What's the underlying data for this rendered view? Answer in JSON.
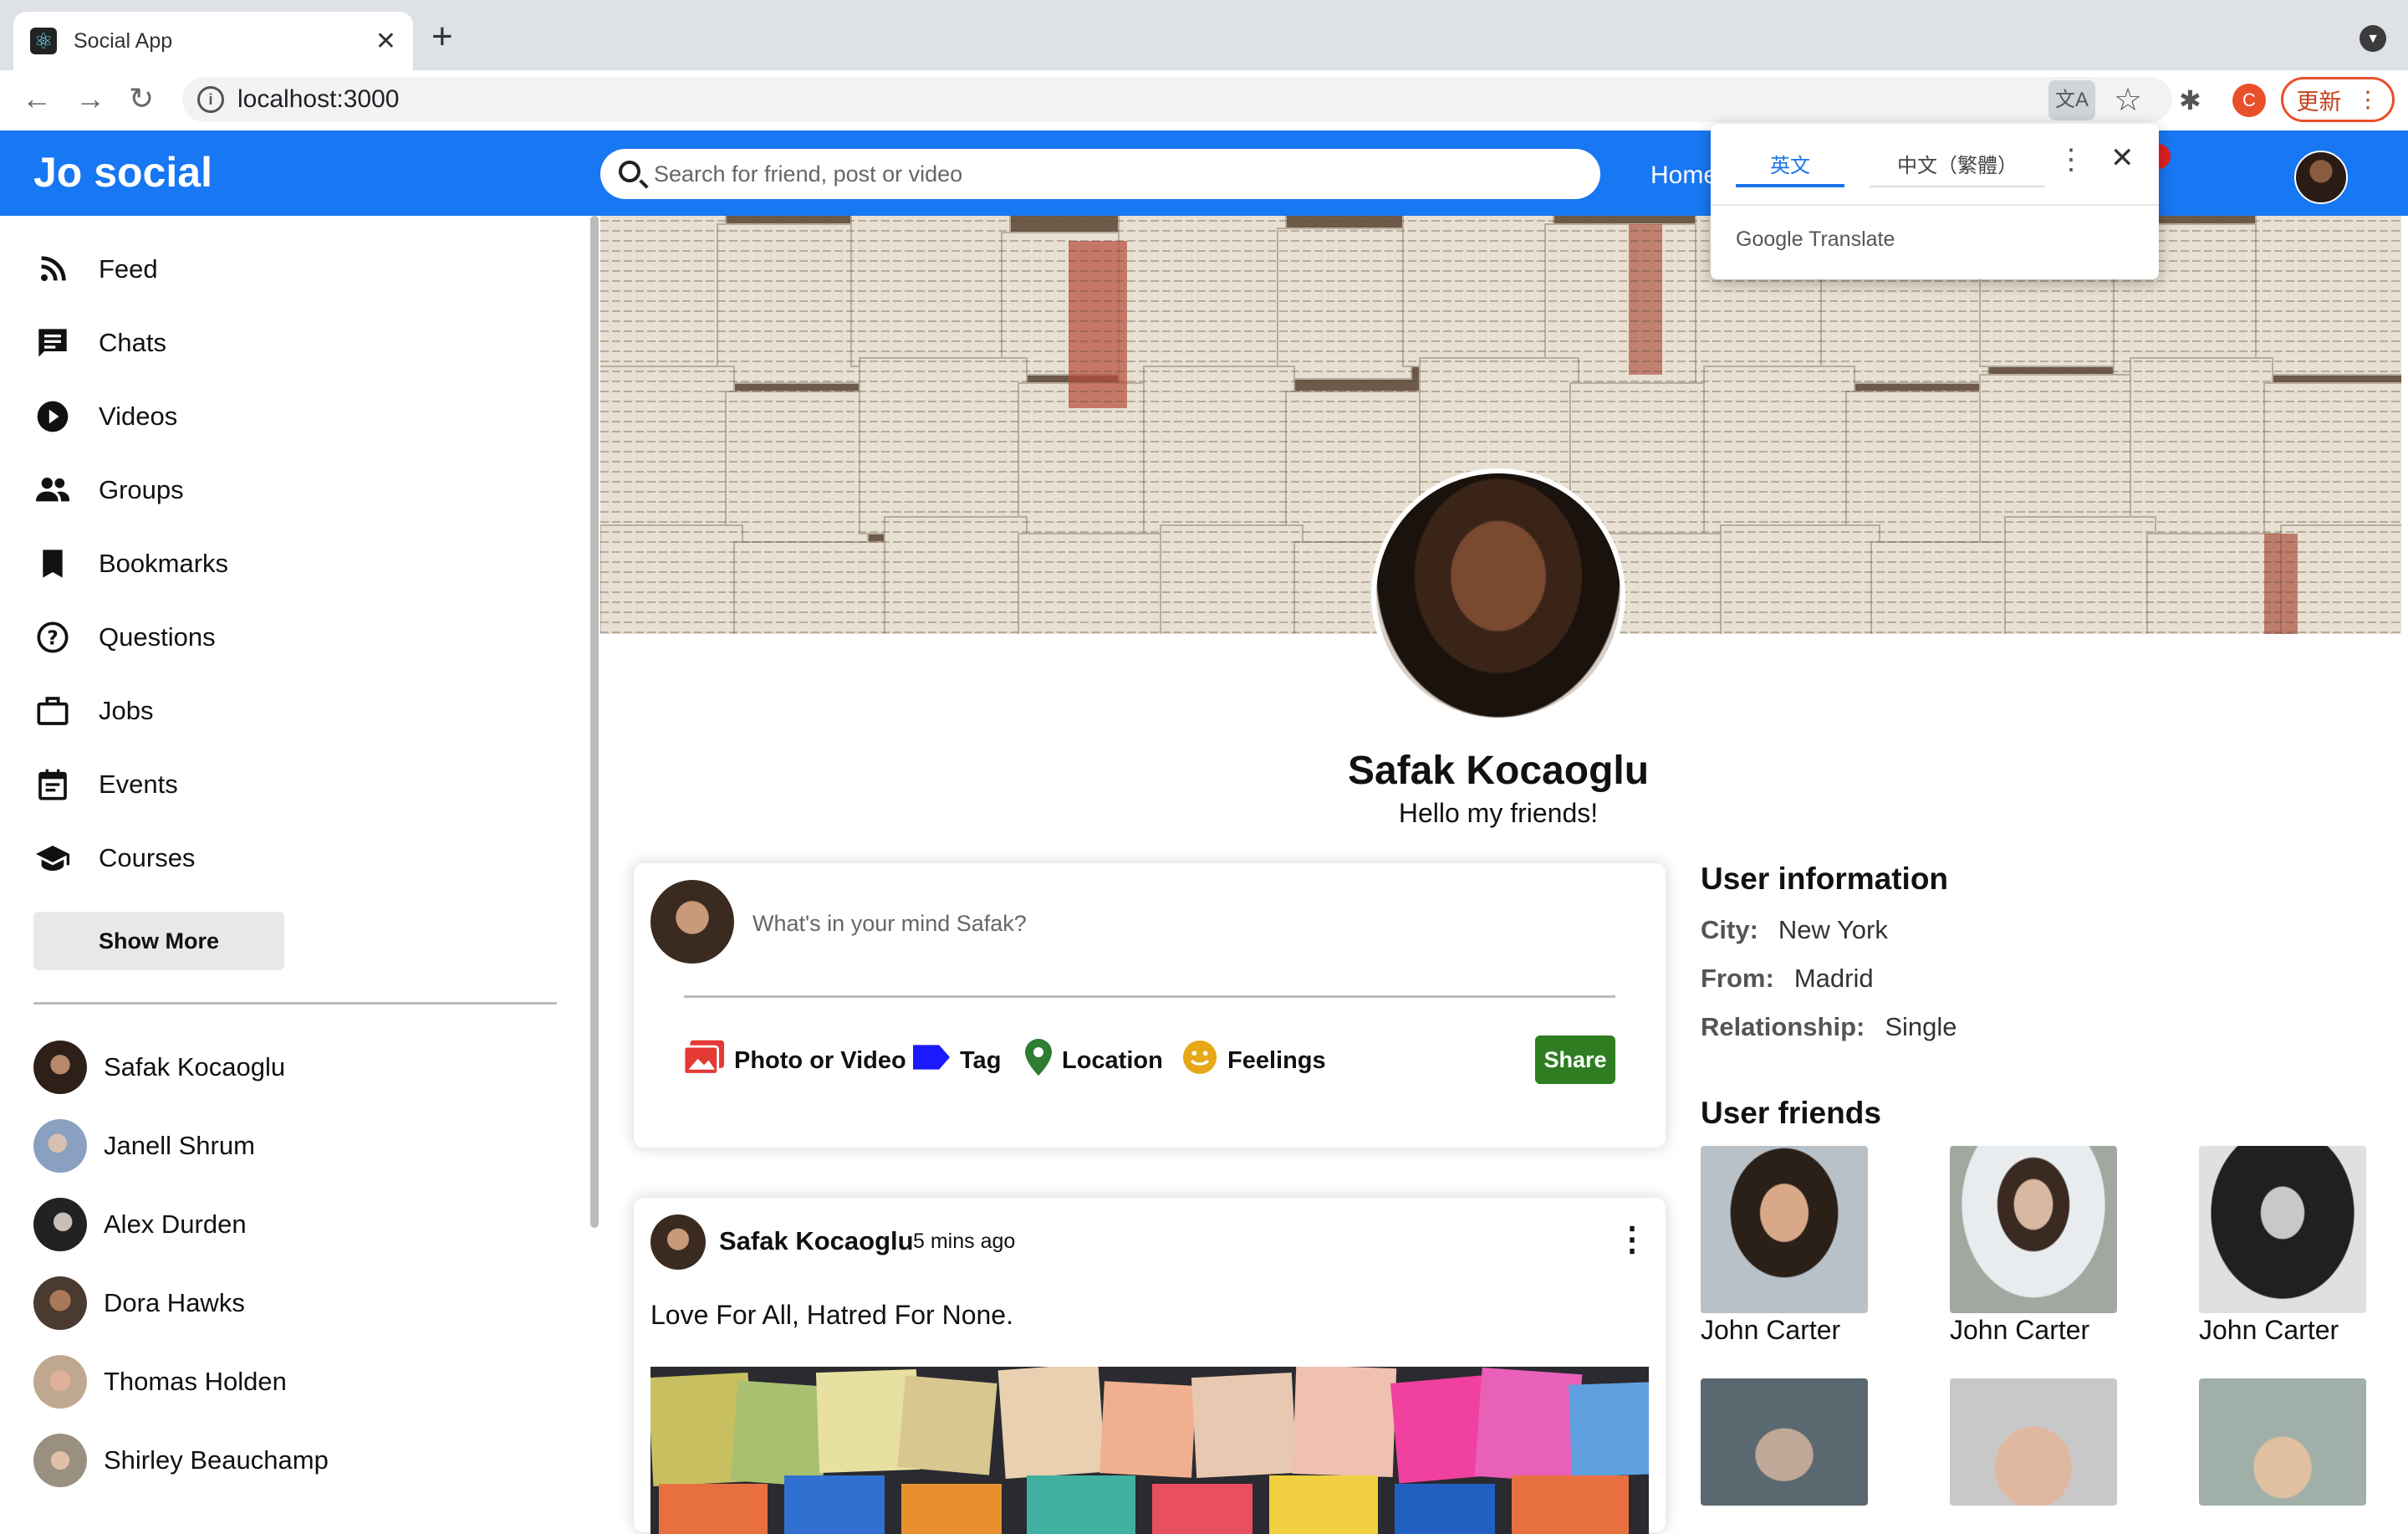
{
  "browser": {
    "tab_title": "Social App",
    "url": "localhost:3000",
    "update_label": "更新"
  },
  "topbar": {
    "logo": "Jo social",
    "search_placeholder": "Search for friend, post or video",
    "home_link": "Home"
  },
  "translate_popup": {
    "lang_source": "英文",
    "lang_target": "中文（繁體）",
    "brand": "Google Translate"
  },
  "sidebar": {
    "menu": [
      {
        "label": "Feed",
        "icon": "rss-icon"
      },
      {
        "label": "Chats",
        "icon": "chat-icon"
      },
      {
        "label": "Videos",
        "icon": "play-circle-icon"
      },
      {
        "label": "Groups",
        "icon": "group-icon"
      },
      {
        "label": "Bookmarks",
        "icon": "bookmark-icon"
      },
      {
        "label": "Questions",
        "icon": "help-circle-icon"
      },
      {
        "label": "Jobs",
        "icon": "briefcase-icon"
      },
      {
        "label": "Events",
        "icon": "calendar-icon"
      },
      {
        "label": "Courses",
        "icon": "school-icon"
      }
    ],
    "show_more": "Show More",
    "friends": [
      {
        "name": "Safak Kocaoglu"
      },
      {
        "name": "Janell Shrum"
      },
      {
        "name": "Alex Durden"
      },
      {
        "name": "Dora Hawks"
      },
      {
        "name": "Thomas Holden"
      },
      {
        "name": "Shirley Beauchamp"
      }
    ]
  },
  "profile": {
    "name": "Safak Kocaoglu",
    "description": "Hello my friends!"
  },
  "share": {
    "placeholder": "What's in your mind Safak?",
    "options": [
      "Photo or Video",
      "Tag",
      "Location",
      "Feelings"
    ],
    "button": "Share",
    "colors": {
      "photo": "#e53935",
      "tag": "#1a1aff",
      "location": "#2e7d32",
      "feelings": "#e6a817",
      "share_button": "#2e7d20"
    }
  },
  "post": {
    "author": "Safak Kocaoglu",
    "time": "5 mins ago",
    "text": "Love For All, Hatred For None."
  },
  "rightbar": {
    "info_title": "User information",
    "info": [
      {
        "key": "City:",
        "value": "New York"
      },
      {
        "key": "From:",
        "value": "Madrid"
      },
      {
        "key": "Relationship:",
        "value": "Single"
      }
    ],
    "friends_title": "User friends",
    "friends": [
      {
        "name": "John Carter"
      },
      {
        "name": "John Carter"
      },
      {
        "name": "John Carter"
      }
    ]
  },
  "colors": {
    "topbar": "#1877f2"
  }
}
